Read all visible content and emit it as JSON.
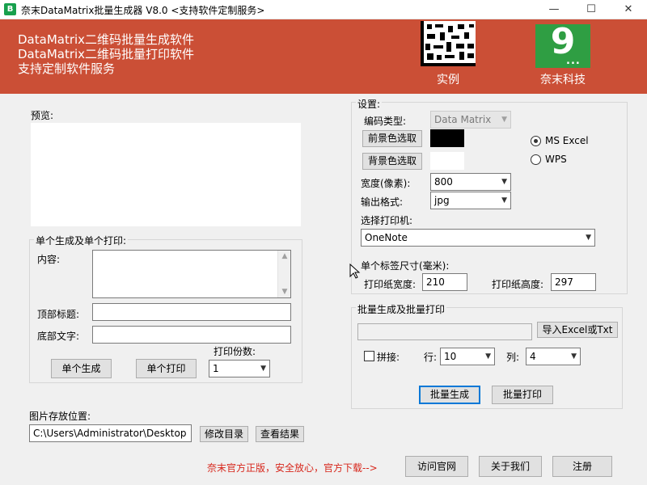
{
  "window": {
    "title": "奈末DataMatrix批量生成器 V8.0  <支持软件定制服务>",
    "app_icon": "B",
    "minimize_glyph": "—",
    "maximize_glyph": "☐",
    "close_glyph": "✕"
  },
  "banner": {
    "line1": "DataMatrix二维码批量生成软件",
    "line2": "DataMatrix二维码批量打印软件",
    "line3": "支持定制软件服务",
    "example_label": "实例",
    "logo_text": "9",
    "logo_dots": "...",
    "brand_label": "奈末科技",
    "color": "#cb4f36"
  },
  "preview": {
    "label": "预览:"
  },
  "single": {
    "group_title": "单个生成及单个打印:",
    "content_label": "内容:",
    "content_value": "",
    "top_title_label": "顶部标题:",
    "top_title_value": "",
    "bottom_text_label": "底部文字:",
    "bottom_text_value": "",
    "copies_label": "打印份数:",
    "copies_value": "1",
    "generate_button": "单个生成",
    "print_button": "单个打印"
  },
  "storage": {
    "label": "图片存放位置:",
    "path": "C:\\Users\\Administrator\\Desktop",
    "change_button": "修改目录",
    "view_button": "查看结果"
  },
  "settings": {
    "group_title": "设置:",
    "code_type_label": "编码类型:",
    "code_type_value": "Data Matrix",
    "fg_button": "前景色选取",
    "fg_color": "#000000",
    "bg_button": "背景色选取",
    "bg_color": "#ffffff",
    "radio_ms_excel": "MS  Excel",
    "radio_wps": "WPS",
    "ms_excel_selected": true,
    "width_label": "宽度(像素):",
    "width_value": "800",
    "format_label": "输出格式:",
    "format_value": "jpg",
    "printer_label": "选择打印机:",
    "printer_value": "OneNote",
    "label_size_title": "单个标签尺寸(毫米):",
    "paper_width_label": "打印纸宽度:",
    "paper_width_value": "210",
    "paper_height_label": "打印纸高度:",
    "paper_height_value": "297"
  },
  "batch": {
    "group_title": "批量生成及批量打印",
    "file_path": "",
    "import_button": "导入Excel或Txt",
    "stitch_label": "拼接:",
    "stitch_checked": false,
    "row_label": "行:",
    "row_value": "10",
    "col_label": "列:",
    "col_value": "4",
    "generate_button": "批量生成",
    "print_button": "批量打印"
  },
  "footer": {
    "notice": "奈末官方正版，安全放心，官方下载-->",
    "notice_color": "#d7261b",
    "visit_button": "访问官网",
    "about_button": "关于我们",
    "register_button": "注册"
  }
}
